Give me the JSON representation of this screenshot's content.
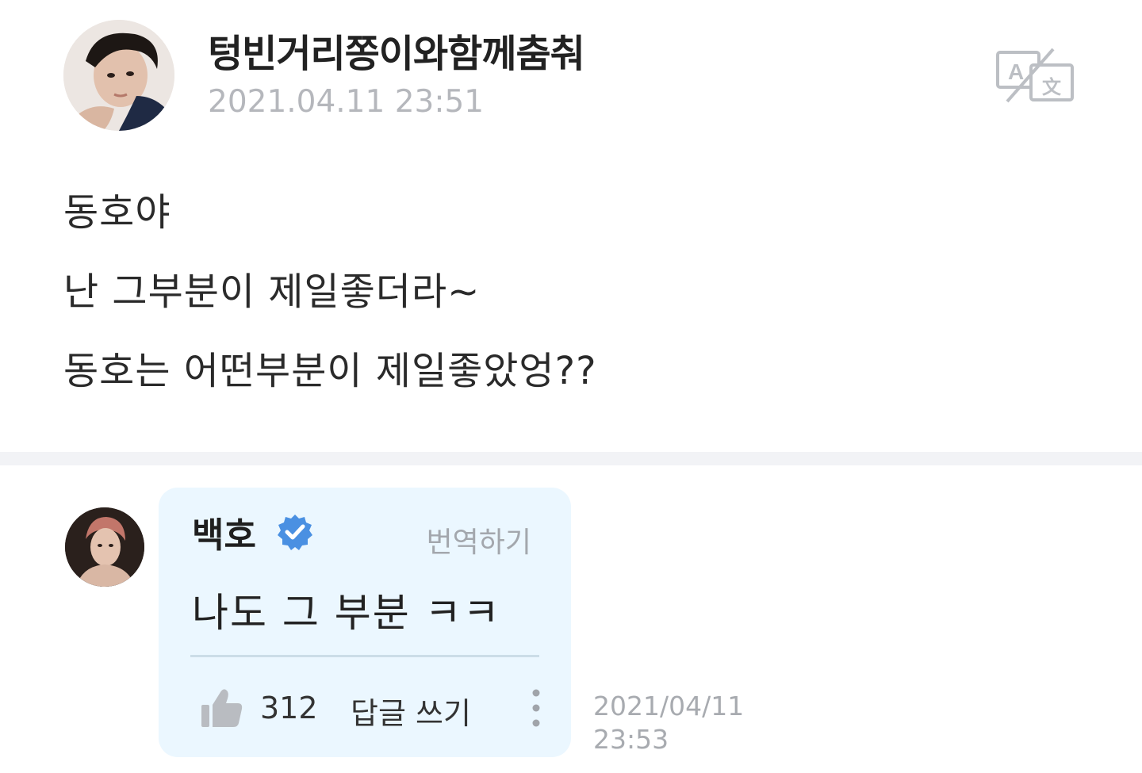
{
  "post": {
    "author": "텅빈거리쫑이와함께춤춰",
    "date": "2021.04.11 23:51",
    "lines": [
      "동호야",
      "난 그부분이 제일좋더라~",
      "동호는 어떤부분이 제일좋았엉??"
    ],
    "translate_icon": "translate-icon"
  },
  "comment": {
    "author": "백호",
    "verified_icon": "verified-badge-icon",
    "translate_label": "번역하기",
    "text": "나도 그 부분 ㅋㅋ",
    "likes": "312",
    "like_icon": "thumbs-up-icon",
    "reply_label": "답글 쓰기",
    "more_icon": "more-vertical-icon",
    "date": "2021/04/11",
    "time": "23:53"
  },
  "colors": {
    "bubble_background": "#ebf7ff",
    "verified_blue": "#4a90e2",
    "muted_text": "#b5b7bc",
    "separator": "#f2f3f6"
  }
}
